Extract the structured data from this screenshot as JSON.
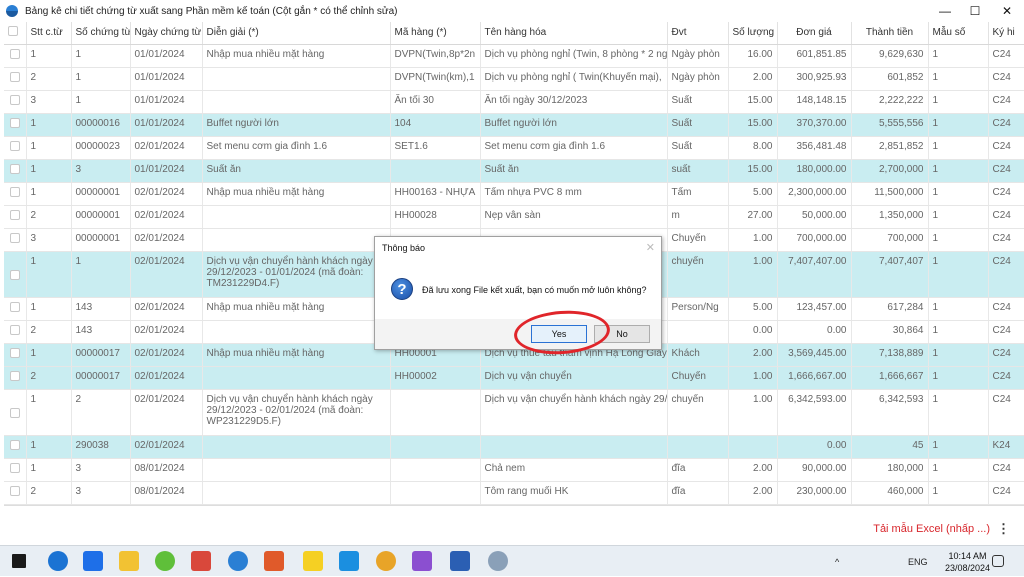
{
  "window": {
    "title": "Bảng kê chi tiết chứng từ xuất sang Phần mềm kế toán (Cột gắn * có thể chỉnh sửa)",
    "minimize": "—",
    "maximize": "☐",
    "close": "✕"
  },
  "columns": [
    "Stt c.từ",
    "Số chứng từ",
    "Ngày chứng từ",
    "Diễn giải (*)",
    "Mã hàng (*)",
    "Tên hàng hóa",
    "Đvt",
    "Số lượng",
    "Đơn giá",
    "Thành tiền",
    "Mẫu số",
    "Ký hi"
  ],
  "rows": [
    {
      "hl": false,
      "stt": "1",
      "so_ct": "1",
      "ngay": "01/01/2024",
      "dien_giai": "Nhập mua nhiều mặt hàng",
      "ma_hang": "DVPN(Twin,8p*2n",
      "ten_hang": "Dịch vụ phòng nghỉ (Twin, 8 phòng * 2 ng",
      "dvt": "Ngày phòn",
      "so_luong": "16.00",
      "don_gia": "601,851.85",
      "thanh_tien": "9,629,630",
      "mau_so": "1",
      "ky_hieu": "C24"
    },
    {
      "hl": false,
      "stt": "2",
      "so_ct": "1",
      "ngay": "01/01/2024",
      "dien_giai": "",
      "ma_hang": "DVPN(Twin(km),1",
      "ten_hang": "Dịch vụ phòng nghỉ ( Twin(Khuyến mại), ",
      "dvt": "Ngày phòn",
      "so_luong": "2.00",
      "don_gia": "300,925.93",
      "thanh_tien": "601,852",
      "mau_so": "1",
      "ky_hieu": "C24"
    },
    {
      "hl": false,
      "stt": "3",
      "so_ct": "1",
      "ngay": "01/01/2024",
      "dien_giai": "",
      "ma_hang": "Ăn tối 30",
      "ten_hang": "Ăn tối ngày 30/12/2023",
      "dvt": "Suất",
      "so_luong": "15.00",
      "don_gia": "148,148.15",
      "thanh_tien": "2,222,222",
      "mau_so": "1",
      "ky_hieu": "C24"
    },
    {
      "hl": true,
      "stt": "1",
      "so_ct": "00000016",
      "ngay": "01/01/2024",
      "dien_giai": "Buffet người lớn",
      "ma_hang": "104",
      "ten_hang": "Buffet người lớn",
      "dvt": "Suất",
      "so_luong": "15.00",
      "don_gia": "370,370.00",
      "thanh_tien": "5,555,556",
      "mau_so": "1",
      "ky_hieu": "C24"
    },
    {
      "hl": false,
      "stt": "1",
      "so_ct": "00000023",
      "ngay": "02/01/2024",
      "dien_giai": "Set menu cơm gia đình 1.6",
      "ma_hang": "SET1.6",
      "ten_hang": "Set menu cơm gia đình 1.6",
      "dvt": "Suất",
      "so_luong": "8.00",
      "don_gia": "356,481.48",
      "thanh_tien": "2,851,852",
      "mau_so": "1",
      "ky_hieu": "C24"
    },
    {
      "hl": true,
      "stt": "1",
      "so_ct": "3",
      "ngay": "01/01/2024",
      "dien_giai": "Suất ăn",
      "ma_hang": "",
      "ten_hang": "Suất ăn",
      "dvt": "suất",
      "so_luong": "15.00",
      "don_gia": "180,000.00",
      "thanh_tien": "2,700,000",
      "mau_so": "1",
      "ky_hieu": "C24"
    },
    {
      "hl": false,
      "stt": "1",
      "so_ct": "00000001",
      "ngay": "02/01/2024",
      "dien_giai": "Nhập mua nhiều mặt hàng",
      "ma_hang": "HH00163 - NHỰA",
      "ten_hang": "Tấm nhựa PVC 8 mm",
      "dvt": "Tấm",
      "so_luong": "5.00",
      "don_gia": "2,300,000.00",
      "thanh_tien": "11,500,000",
      "mau_so": "1",
      "ky_hieu": "C24"
    },
    {
      "hl": false,
      "stt": "2",
      "so_ct": "00000001",
      "ngay": "02/01/2024",
      "dien_giai": "",
      "ma_hang": "HH00028",
      "ten_hang": "Nẹp vân sàn",
      "dvt": "m",
      "so_luong": "27.00",
      "don_gia": "50,000.00",
      "thanh_tien": "1,350,000",
      "mau_so": "1",
      "ky_hieu": "C24"
    },
    {
      "hl": false,
      "stt": "3",
      "so_ct": "00000001",
      "ngay": "02/01/2024",
      "dien_giai": "",
      "ma_hang": "",
      "ten_hang": "",
      "dvt": "Chuyến",
      "so_luong": "1.00",
      "don_gia": "700,000.00",
      "thanh_tien": "700,000",
      "mau_so": "1",
      "ky_hieu": "C24"
    },
    {
      "hl": true,
      "tall": true,
      "stt": "1",
      "so_ct": "1",
      "ngay": "02/01/2024",
      "dien_giai": "Dịch vụ vận chuyển hành khách ngày 29/12/2023 - 01/01/2024 (mã đoàn: TM231229D4.F)",
      "ma_hang": "",
      "ten_hang": "",
      "dvt": "chuyến",
      "so_luong": "1.00",
      "don_gia": "7,407,407.00",
      "thanh_tien": "7,407,407",
      "mau_so": "1",
      "ky_hieu": "C24"
    },
    {
      "hl": false,
      "stt": "1",
      "so_ct": "143",
      "ngay": "02/01/2024",
      "dien_giai": "Nhập mua nhiều mặt hàng",
      "ma_hang": "",
      "ten_hang": "",
      "dvt": "Person/Ng",
      "so_luong": "5.00",
      "don_gia": "123,457.00",
      "thanh_tien": "617,284",
      "mau_so": "1",
      "ky_hieu": "C24"
    },
    {
      "hl": false,
      "stt": "2",
      "so_ct": "143",
      "ngay": "02/01/2024",
      "dien_giai": "",
      "ma_hang": "",
      "ten_hang": "",
      "dvt": "",
      "so_luong": "0.00",
      "don_gia": "0.00",
      "thanh_tien": "30,864",
      "mau_so": "1",
      "ky_hieu": "C24"
    },
    {
      "hl": true,
      "stt": "1",
      "so_ct": "00000017",
      "ngay": "02/01/2024",
      "dien_giai": "Nhập mua nhiều mặt hàng",
      "ma_hang": "HH00001",
      "ten_hang": "Dịch vụ thuê tàu thăm vịnh Hạ Long Giấy",
      "dvt": "Khách",
      "so_luong": "2.00",
      "don_gia": "3,569,445.00",
      "thanh_tien": "7,138,889",
      "mau_so": "1",
      "ky_hieu": "C24"
    },
    {
      "hl": true,
      "stt": "2",
      "so_ct": "00000017",
      "ngay": "02/01/2024",
      "dien_giai": "",
      "ma_hang": "HH00002",
      "ten_hang": "Dịch vụ vận chuyển",
      "dvt": "Chuyến",
      "so_luong": "1.00",
      "don_gia": "1,666,667.00",
      "thanh_tien": "1,666,667",
      "mau_so": "1",
      "ky_hieu": "C24"
    },
    {
      "hl": false,
      "tall": true,
      "stt": "1",
      "so_ct": "2",
      "ngay": "02/01/2024",
      "dien_giai": "Dịch vụ vận chuyển hành khách ngày 29/12/2023 - 02/01/2024 (mã đoàn: WP231229D5.F)",
      "ma_hang": "",
      "ten_hang": "Dịch vụ vận chuyển hành khách ngày 29/",
      "dvt": "chuyến",
      "so_luong": "1.00",
      "don_gia": "6,342,593.00",
      "thanh_tien": "6,342,593",
      "mau_so": "1",
      "ky_hieu": "C24"
    },
    {
      "hl": true,
      "stt": "1",
      "so_ct": "290038",
      "ngay": "02/01/2024",
      "dien_giai": "",
      "ma_hang": "",
      "ten_hang": "",
      "dvt": "",
      "so_luong": "",
      "don_gia": "0.00",
      "thanh_tien": "45",
      "mau_so": "1",
      "ky_hieu": "K24"
    },
    {
      "hl": false,
      "stt": "1",
      "so_ct": "3",
      "ngay": "08/01/2024",
      "dien_giai": "",
      "ma_hang": "",
      "ten_hang": "Chả nem",
      "dvt": "đĩa",
      "so_luong": "2.00",
      "don_gia": "90,000.00",
      "thanh_tien": "180,000",
      "mau_so": "1",
      "ky_hieu": "C24"
    },
    {
      "hl": false,
      "stt": "2",
      "so_ct": "3",
      "ngay": "08/01/2024",
      "dien_giai": "",
      "ma_hang": "",
      "ten_hang": "Tôm rang muối HK",
      "dvt": "đĩa",
      "so_luong": "2.00",
      "don_gia": "230,000.00",
      "thanh_tien": "460,000",
      "mau_so": "1",
      "ky_hieu": "C24"
    }
  ],
  "dialog": {
    "title": "Thông báo",
    "close": "✕",
    "icon": "question-icon",
    "message": "Đã lưu xong File kết xuất, bạn có muốn mở luôn không?",
    "yes": "Yes",
    "no": "No"
  },
  "footer": {
    "link": "Tải mẫu Excel (nhấp ...)",
    "more": "⋮"
  },
  "taskbar": {
    "tray_chevron": "^",
    "lang_indicator": "ENG",
    "time": "10:14 AM",
    "date": "23/08/2024"
  },
  "colors": {
    "highlight_row": "#c9edf1",
    "link_red": "#d8262c",
    "annotation_circle": "#e0252a"
  }
}
